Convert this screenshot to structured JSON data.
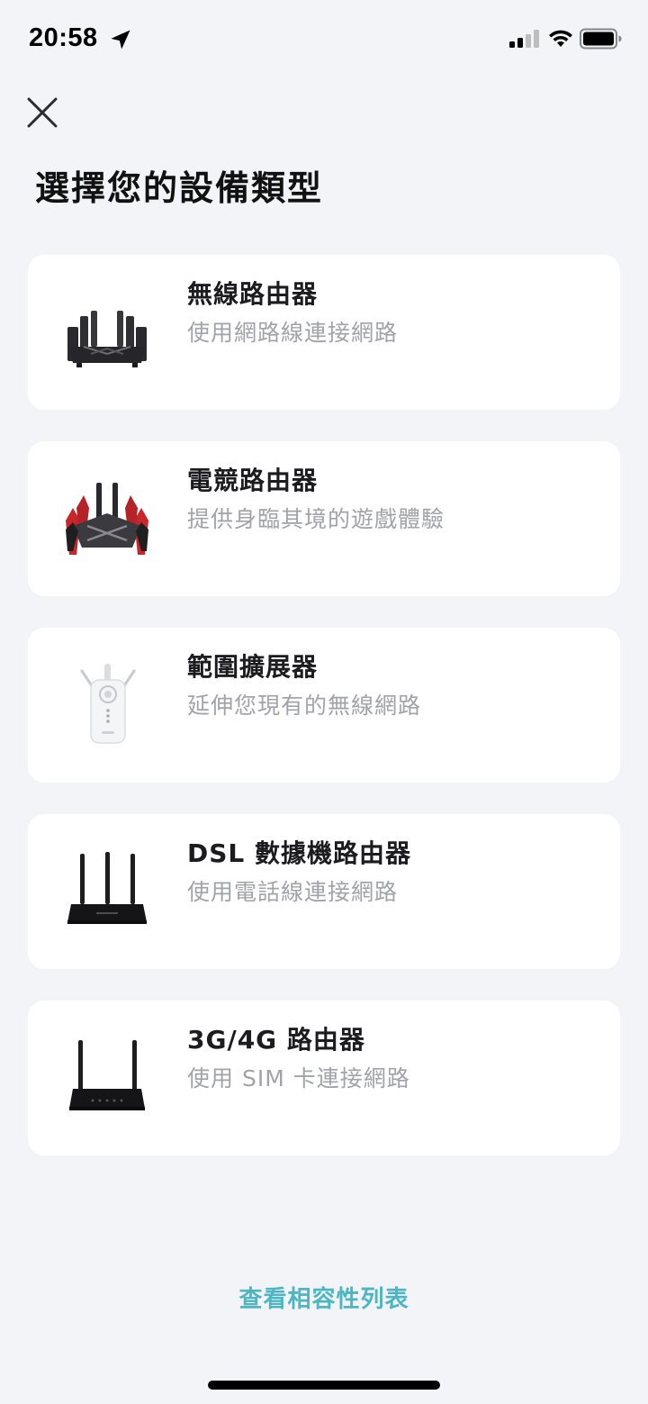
{
  "status_bar": {
    "time": "20:58",
    "icons": [
      "location-arrow-icon",
      "signal-icon",
      "wifi-icon",
      "battery-icon"
    ]
  },
  "header": {
    "close_icon": "close-icon",
    "title": "選擇您的設備類型"
  },
  "devices": [
    {
      "title": "無線路由器",
      "subtitle": "使用網路線連接網路",
      "image": "wireless-router"
    },
    {
      "title": "電競路由器",
      "subtitle": "提供身臨其境的遊戲體驗",
      "image": "gaming-router"
    },
    {
      "title": "範圍擴展器",
      "subtitle": "延伸您現有的無線網路",
      "image": "range-extender"
    },
    {
      "title": "DSL 數據機路由器",
      "subtitle": "使用電話線連接網路",
      "image": "dsl-modem-router"
    },
    {
      "title": "3G/4G 路由器",
      "subtitle": "使用 SIM 卡連接網路",
      "image": "lte-router"
    }
  ],
  "footer": {
    "compat_link": "查看相容性列表"
  },
  "colors": {
    "background": "#f3f4f8",
    "card": "#ffffff",
    "accent": "#4db6c3",
    "subtitle": "#a2a3a8"
  }
}
